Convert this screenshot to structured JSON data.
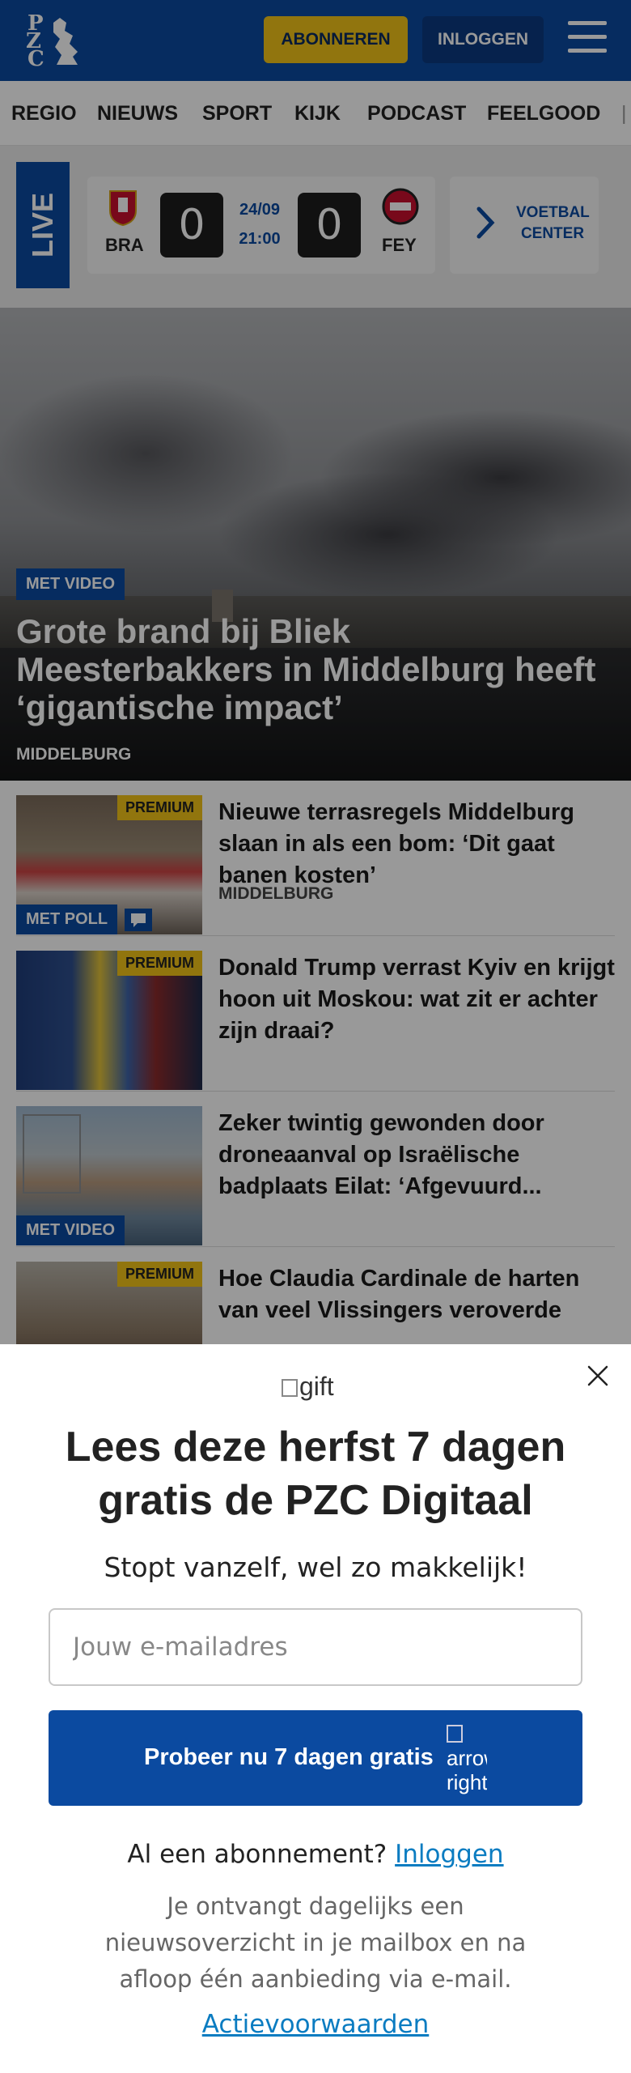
{
  "header": {
    "logo": {
      "l1": "P",
      "l2": "Z",
      "l3": "C"
    },
    "subscribe_label": "ABONNEREN",
    "login_label": "INLOGGEN",
    "brand_color": "#0b4aa0",
    "accent_color": "#f2c418"
  },
  "nav": {
    "items": [
      "REGIO",
      "NIEUWS",
      "SPORT",
      "KIJK",
      "PODCAST",
      "FEELGOOD"
    ]
  },
  "live": {
    "badge": "LIVE",
    "match": {
      "home_team": "BRA",
      "away_team": "FEY",
      "home_score": "0",
      "away_score": "0",
      "date": "24/09",
      "time": "21:00"
    },
    "football_center": "VOETBAL CENTER"
  },
  "hero": {
    "badge": "MET VIDEO",
    "title": "Grote brand bij Bliek Meesterbakkers in Middelburg heeft ‘gigantische impact’",
    "location": "MIDDELBURG"
  },
  "articles": [
    {
      "title": "Nieuwe terrasregels Middelburg slaan in als een bom: ‘Dit gaat banen kosten’",
      "location": "MIDDELBURG",
      "premium": "PREMIUM",
      "badge": "MET POLL"
    },
    {
      "title": "Donald Trump verrast Kyiv en krijgt hoon uit Moskou: wat zit er achter zijn draai?",
      "premium": "PREMIUM"
    },
    {
      "title": "Zeker twintig gewonden door droneaanval op Israëlische badplaats Eilat: ‘Afgevuurd...",
      "badge": "MET VIDEO"
    },
    {
      "title": "Hoe Claudia Cardinale de harten van veel Vlissingers veroverde",
      "premium": "PREMIUM"
    }
  ],
  "popup": {
    "gift_alt": "gift",
    "title": "Lees deze herfst 7 dagen gratis de PZC Digitaal",
    "subtitle": "Stopt vanzelf, wel zo makkelijk!",
    "email_placeholder": "Jouw e-mailadres",
    "cta_label": "Probeer nu 7 dagen gratis",
    "cta_arrow_alt": "arrow right",
    "have_subscription": "Al een abonnement?",
    "login_link": "Inloggen",
    "disclaimer": "Je ontvangt dagelijks een nieuwsoverzicht in je mailbox en na afloop één aanbieding via e-mail.",
    "terms_link": "Actievoorwaarden"
  }
}
